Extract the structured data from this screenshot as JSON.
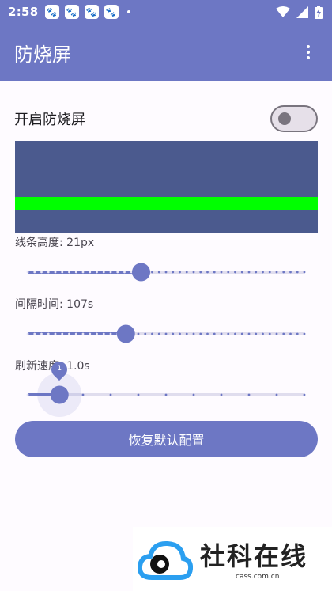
{
  "status_bar": {
    "time": "2:58",
    "notif_glyph": "🐾",
    "notif_count": 4
  },
  "app_bar": {
    "title": "防烧屏"
  },
  "toggle": {
    "label": "开启防烧屏",
    "state": "off"
  },
  "colors": {
    "accent": "#6d77c4",
    "preview_bg": "#4b5a8e",
    "line": "#00ff00"
  },
  "sliders": [
    {
      "label": "线条高度: 21px",
      "fraction": 0.41,
      "steps": 40
    },
    {
      "label": "间隔时间: 107s",
      "fraction": 0.355,
      "steps": 40
    },
    {
      "label": "刷新速度: 1.0s",
      "fraction": 0.115,
      "steps": 10,
      "bubble": "1"
    }
  ],
  "reset_button": {
    "label": "恢复默认配置"
  },
  "watermark": {
    "text": "社科在线",
    "domain": "cass.com.cn"
  }
}
